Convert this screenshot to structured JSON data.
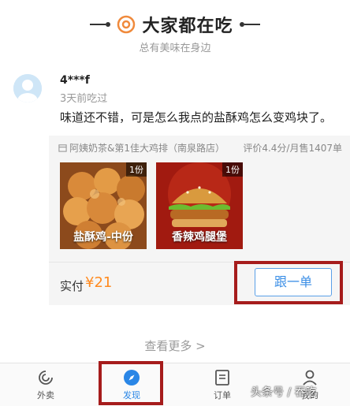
{
  "header": {
    "title": "大家都在吃",
    "subtitle": "总有美味在身边"
  },
  "review": {
    "username": "4***f",
    "time": "3天前吃过",
    "text": "味道还不错，可是怎么我点的盐酥鸡怎么变鸡块了。"
  },
  "store": {
    "name": "阿姨奶茶&第1佳大鸡排（南泉路店）",
    "stats": "评价4.4分/月售1407单"
  },
  "dishes": [
    {
      "name": "盐酥鸡-中份",
      "qty": "1份"
    },
    {
      "name": "香辣鸡腿堡",
      "qty": "1份"
    }
  ],
  "order": {
    "pay_label": "实付",
    "amount": "¥21",
    "follow_label": "跟一单"
  },
  "see_more": "查看更多 >",
  "tabs": [
    {
      "label": "外卖",
      "icon": "waimai-icon"
    },
    {
      "label": "发现",
      "icon": "compass-icon",
      "active": true
    },
    {
      "label": "订单",
      "icon": "order-list-icon"
    },
    {
      "label": "我的",
      "icon": "user-icon"
    }
  ],
  "watermark": "头条号 / 吞吃",
  "colors": {
    "accent": "#3a8ee6",
    "price": "#ff8a1f",
    "annotation": "#a61c1c",
    "logo": "#f08a3c"
  }
}
